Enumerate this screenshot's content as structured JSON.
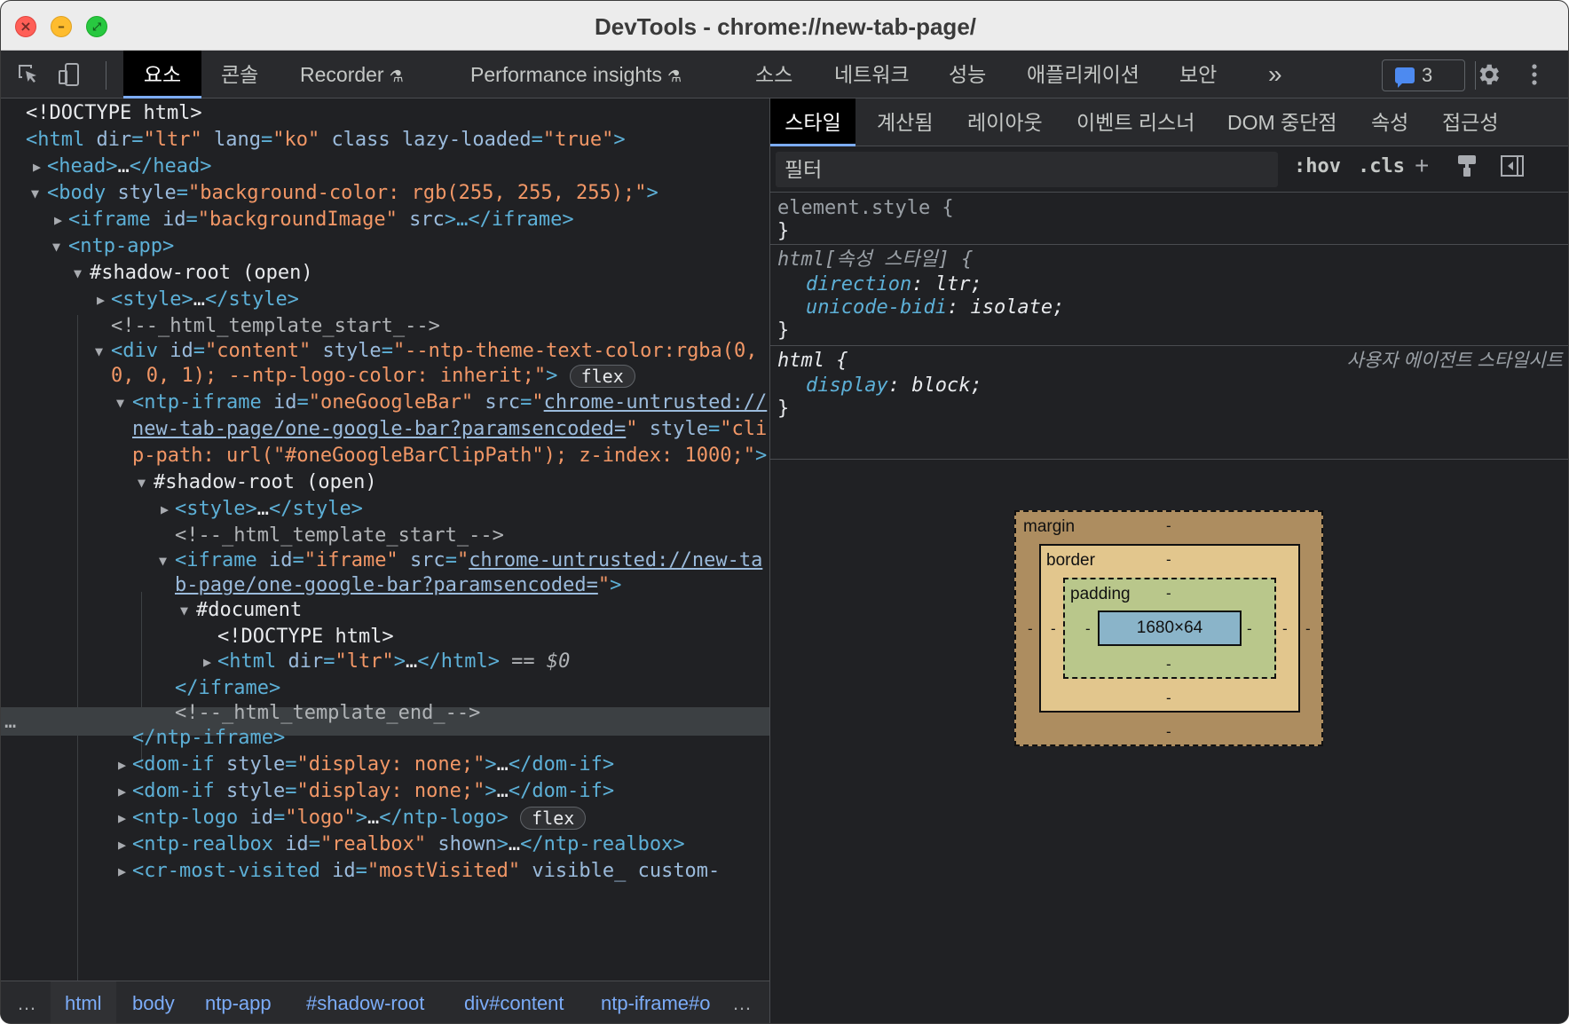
{
  "window": {
    "title": "DevTools - chrome://new-tab-page/"
  },
  "toolbar": {
    "tabs": [
      "요소",
      "콘솔",
      "Recorder",
      "Performance insights",
      "소스",
      "네트워크",
      "성능",
      "애플리케이션",
      "보안"
    ],
    "more": "»",
    "issues_count": "3",
    "experimental_icon": "flask-icon"
  },
  "elements": {
    "lines": [
      {
        "t1": "<!DOCTYPE html>"
      },
      {
        "t1": "<html ",
        "a1": "dir",
        "v1": "\"ltr\"",
        "a2": "lang",
        "v2": "\"ko\"",
        "a3": "class",
        "a4": "lazy-loaded",
        "v4": "\"true\"",
        "end": ">"
      },
      {
        "t1": "<head>",
        "mid": "…",
        "t2": "</head>"
      },
      {
        "t1": "<body ",
        "a1": "style",
        "v1": "\"background-color: rgb(255, 255, 255);\"",
        "end": ">"
      },
      {
        "t1": "<iframe ",
        "a1": "id",
        "v1": "\"backgroundImage\"",
        "a2": "src",
        "mid": ">…",
        "t2": "</iframe>"
      },
      {
        "t1": "<ntp-app>"
      },
      {
        "x1": "#shadow-root (open)"
      },
      {
        "t1": "<style>",
        "mid": "…",
        "t2": "</style>"
      },
      {
        "c1": "<!--_html_template_start_-->"
      },
      {
        "t1": "<div ",
        "a1": "id",
        "v1": "\"content\"",
        "a2": "style",
        "v2": "\"--ntp-theme-text-color:rgba(0,"
      },
      {
        "v1": "0, 0, 1); --ntp-logo-color: inherit;\"",
        "end": ">",
        "badge": "flex"
      },
      {
        "t1": "<ntp-iframe ",
        "a1": "id",
        "v1": "\"oneGoogleBar\"",
        "a2": "src",
        "v2": "\"",
        "link": "chrome-untrusted://"
      },
      {
        "link": "new-tab-page/one-google-bar?paramsencoded=",
        "v1": "\"",
        "a2": "style",
        "v2": "\"cli"
      },
      {
        "v1": "p-path: url(\"#oneGoogleBarClipPath\"); z-index: 1000;\"",
        "end": ">"
      },
      {
        "x1": "#shadow-root (open)"
      },
      {
        "t1": "<style>",
        "mid": "…",
        "t2": "</style>"
      },
      {
        "c1": "<!--_html_template_start_-->"
      },
      {
        "t1": "<iframe ",
        "a1": "id",
        "v1": "\"iframe\"",
        "a2": "src",
        "v2": "\"",
        "link": "chrome-untrusted://new-ta"
      },
      {
        "link": "b-page/one-google-bar?paramsencoded=",
        "v1": "\"",
        "end": ">"
      },
      {
        "x1": "#document"
      },
      {
        "x1": "<!DOCTYPE html>"
      },
      {
        "t1": "<html ",
        "a1": "dir",
        "v1": "\"ltr\"",
        "end": ">",
        "mid": "…",
        "t2": "</html>",
        "sel": " == $0"
      },
      {
        "t1": "</iframe>"
      },
      {
        "c1": "<!--_html_template_end_-->"
      },
      {
        "t1": "</ntp-iframe>"
      },
      {
        "t1": "<dom-if ",
        "a1": "style",
        "v1": "\"display: none;\"",
        "end": ">",
        "mid": "…",
        "t2": "</dom-if>"
      },
      {
        "t1": "<dom-if ",
        "a1": "style",
        "v1": "\"display: none;\"",
        "end": ">",
        "mid": "…",
        "t2": "</dom-if>"
      },
      {
        "t1": "<ntp-logo ",
        "a1": "id",
        "v1": "\"logo\"",
        "end": ">",
        "mid": "…",
        "t2": "</ntp-logo>",
        "badge": "flex"
      },
      {
        "t1": "<ntp-realbox ",
        "a1": "id",
        "v1": "\"realbox\"",
        "a2": "shown",
        "end": ">",
        "mid": "…",
        "t2": "</ntp-realbox>"
      },
      {
        "t1": "<cr-most-visited ",
        "a1": "id",
        "v1": "\"mostVisited\"",
        "a2": "visible_",
        "a3": "custom-"
      }
    ],
    "row_menu": "…"
  },
  "breadcrumbs": {
    "more_left": "…",
    "items": [
      "html",
      "body",
      "ntp-app",
      "#shadow-root",
      "div#content",
      "ntp-iframe#o"
    ],
    "more_right": "…"
  },
  "styles": {
    "tabs": [
      "스타일",
      "계산됨",
      "레이아웃",
      "이벤트 리스너",
      "DOM 중단점",
      "속성",
      "접근성"
    ],
    "filter_placeholder": "필터",
    "hov": ":hov",
    "cls": ".cls",
    "rules": {
      "element_style": "element.style {",
      "close": "}",
      "html_attr_selector": "html[속성 스타일] {",
      "direction_prop": "direction",
      "direction_val": "ltr;",
      "bidi_prop": "unicode-bidi",
      "bidi_val": "isolate;",
      "html_selector": "html {",
      "ua_label": "사용자 에이전트 스타일시트",
      "display_prop": "display",
      "display_val": "block;"
    },
    "box_model": {
      "margin_label": "margin",
      "border_label": "border",
      "padding_label": "padding",
      "content_size": "1680×64",
      "dash": "-"
    }
  },
  "colors": {
    "tag": "#5db0d7",
    "attr_name": "#9bbbdc",
    "attr_value": "#f29766",
    "accent": "#7cacf8"
  }
}
